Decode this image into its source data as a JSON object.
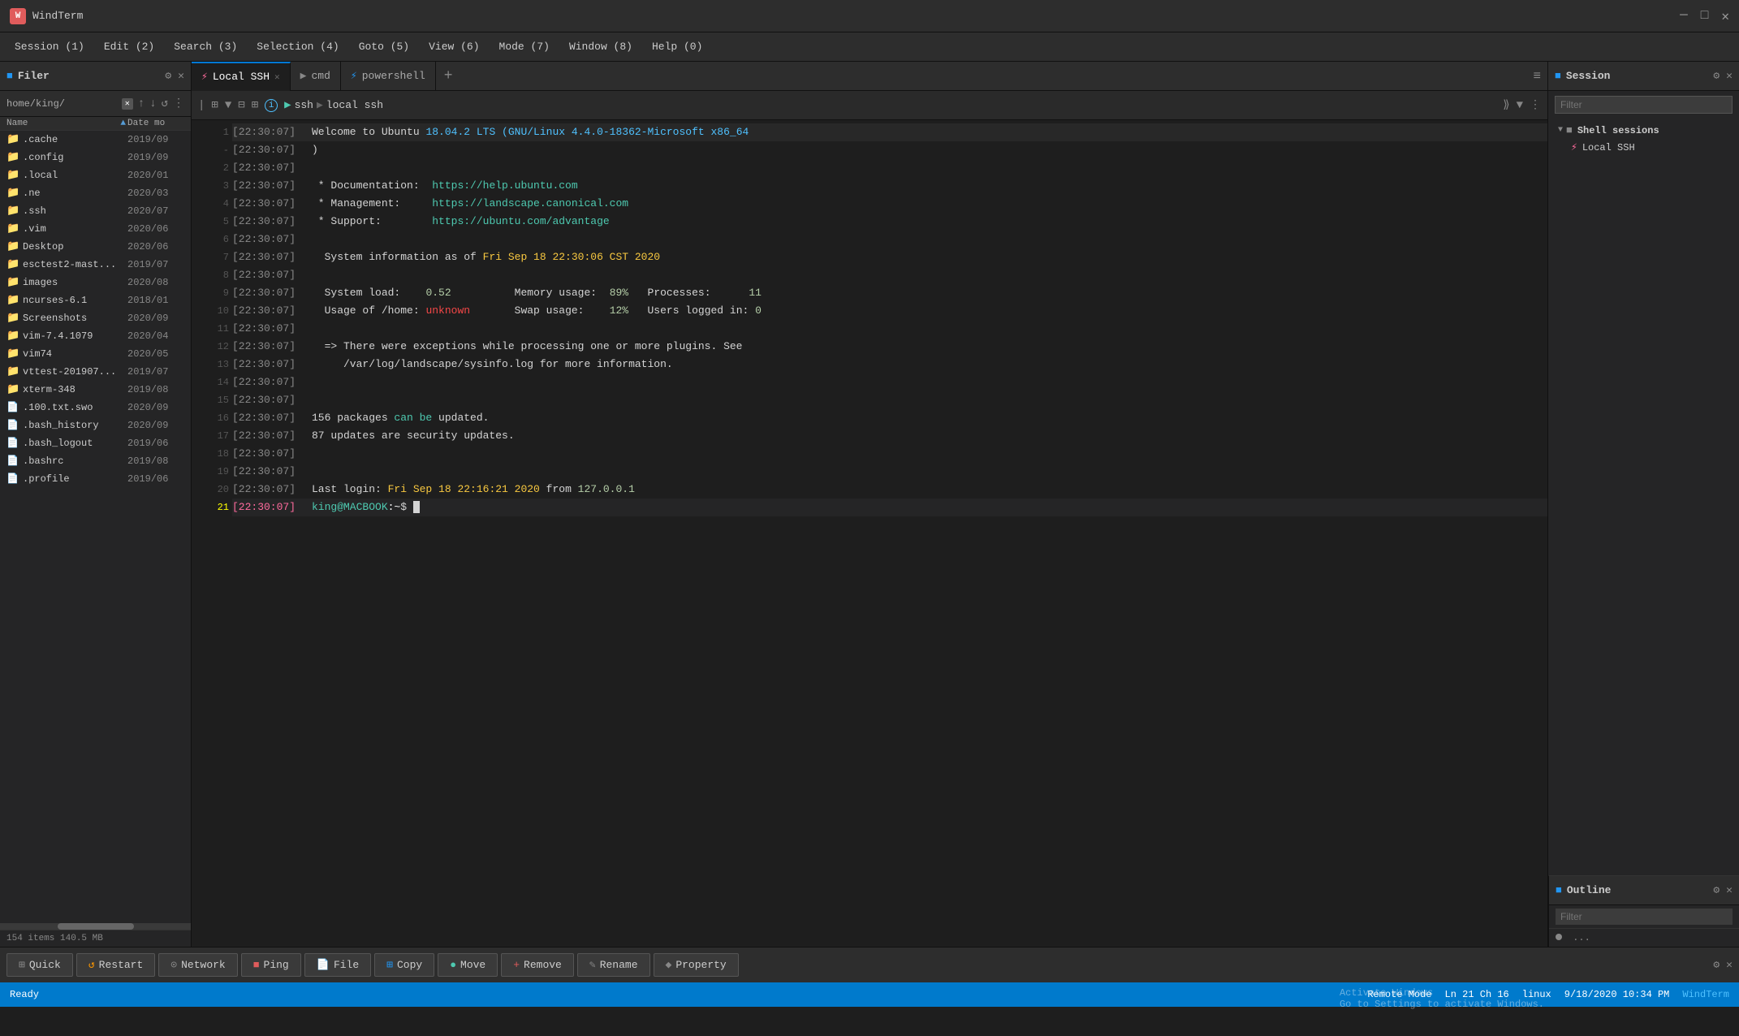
{
  "app": {
    "title": "WindTerm",
    "icon": "W"
  },
  "menu": {
    "items": [
      {
        "label": "Session (1)"
      },
      {
        "label": "Edit (2)"
      },
      {
        "label": "Search (3)"
      },
      {
        "label": "Selection (4)"
      },
      {
        "label": "Goto (5)"
      },
      {
        "label": "View (6)"
      },
      {
        "label": "Mode (7)"
      },
      {
        "label": "Window (8)"
      },
      {
        "label": "Help (0)"
      }
    ]
  },
  "filer": {
    "title": "Filer",
    "path": "home/king/",
    "status": "154 items  140.5 MB",
    "items": [
      {
        "name": ".cache",
        "date": "2019/09",
        "type": "folder"
      },
      {
        "name": ".config",
        "date": "2019/09",
        "type": "folder"
      },
      {
        "name": ".local",
        "date": "2020/01",
        "type": "folder"
      },
      {
        "name": ".ne",
        "date": "2020/03",
        "type": "folder"
      },
      {
        "name": ".ssh",
        "date": "2020/07",
        "type": "folder"
      },
      {
        "name": ".vim",
        "date": "2020/06",
        "type": "folder"
      },
      {
        "name": "Desktop",
        "date": "2020/06",
        "type": "folder"
      },
      {
        "name": "esctest2-mast...",
        "date": "2019/07",
        "type": "folder"
      },
      {
        "name": "images",
        "date": "2020/08",
        "type": "folder"
      },
      {
        "name": "ncurses-6.1",
        "date": "2018/01",
        "type": "folder"
      },
      {
        "name": "Screenshots",
        "date": "2020/09",
        "type": "folder"
      },
      {
        "name": "vim-7.4.1079",
        "date": "2020/04",
        "type": "folder"
      },
      {
        "name": "vim74",
        "date": "2020/05",
        "type": "folder"
      },
      {
        "name": "vttest-201907...",
        "date": "2019/07",
        "type": "folder"
      },
      {
        "name": "xterm-348",
        "date": "2019/08",
        "type": "folder"
      },
      {
        "name": ".100.txt.swo",
        "date": "2020/09",
        "type": "file"
      },
      {
        "name": ".bash_history",
        "date": "2020/09",
        "type": "file"
      },
      {
        "name": ".bash_logout",
        "date": "2019/06",
        "type": "file"
      },
      {
        "name": ".bashrc",
        "date": "2019/08",
        "type": "file"
      },
      {
        "name": ".profile",
        "date": "2019/06",
        "type": "file"
      }
    ]
  },
  "tabs": [
    {
      "label": "Local SSH",
      "type": "ssh",
      "active": true,
      "closable": true
    },
    {
      "label": "cmd",
      "type": "cmd",
      "active": false,
      "closable": false
    },
    {
      "label": "powershell",
      "type": "ps",
      "active": false,
      "closable": false
    }
  ],
  "terminal": {
    "path_parts": [
      "ssh",
      "local ssh"
    ],
    "lines": [
      {
        "num": "1",
        "time": "[22:30:07]",
        "text": "Welcome to Ubuntu 18.04.2 LTS (GNU/Linux 4.4.0-18362-Microsoft x86_64",
        "type": "welcome"
      },
      {
        "num": "-",
        "time": "[22:30:07]",
        "text": ")",
        "type": "normal"
      },
      {
        "num": "2",
        "time": "[22:30:07]",
        "text": "",
        "type": "empty"
      },
      {
        "num": "3",
        "time": "[22:30:07]",
        "text": " * Documentation:  https://help.ubuntu.com",
        "type": "doc"
      },
      {
        "num": "4",
        "time": "[22:30:07]",
        "text": " * Management:     https://landscape.canonical.com",
        "type": "doc"
      },
      {
        "num": "5",
        "time": "[22:30:07]",
        "text": " * Support:        https://ubuntu.com/advantage",
        "type": "doc"
      },
      {
        "num": "6",
        "time": "[22:30:07]",
        "text": "",
        "type": "empty"
      },
      {
        "num": "7",
        "time": "[22:30:07]",
        "text": "  System information as of Fri Sep 18 22:30:06 CST 2020",
        "type": "sysinfo"
      },
      {
        "num": "8",
        "time": "[22:30:07]",
        "text": "",
        "type": "empty"
      },
      {
        "num": "9",
        "time": "[22:30:07]",
        "text": "  System load:    0.52          Memory usage:  89%   Processes:      11",
        "type": "stats"
      },
      {
        "num": "10",
        "time": "[22:30:07]",
        "text": "  Usage of /home: unknown       Swap usage:    12%   Users logged in: 0",
        "type": "stats"
      },
      {
        "num": "11",
        "time": "[22:30:07]",
        "text": "",
        "type": "empty"
      },
      {
        "num": "12",
        "time": "[22:30:07]",
        "text": "  => There were exceptions while processing one or more plugins. See",
        "type": "warning"
      },
      {
        "num": "13",
        "time": "[22:30:07]",
        "text": "     /var/log/landscape/sysinfo.log for more information.",
        "type": "warning"
      },
      {
        "num": "14",
        "time": "[22:30:07]",
        "text": "",
        "type": "empty"
      },
      {
        "num": "15",
        "time": "[22:30:07]",
        "text": "",
        "type": "empty"
      },
      {
        "num": "16",
        "time": "[22:30:07]",
        "text": "156 packages can be updated.",
        "type": "update"
      },
      {
        "num": "17",
        "time": "[22:30:07]",
        "text": "87 updates are security updates.",
        "type": "update"
      },
      {
        "num": "18",
        "time": "[22:30:07]",
        "text": "",
        "type": "empty"
      },
      {
        "num": "19",
        "time": "[22:30:07]",
        "text": "",
        "type": "empty"
      },
      {
        "num": "20",
        "time": "[22:30:07]",
        "text": "Last login: Fri Sep 18 22:16:21 2020 from 127.0.0.1",
        "type": "login"
      },
      {
        "num": "21",
        "time": "[22:30:07]",
        "text": "king@MACBOOK:~$ ",
        "type": "prompt",
        "active": true
      }
    ]
  },
  "session_panel": {
    "title": "Session",
    "filter_placeholder": "Filter",
    "items": [
      {
        "label": "Shell sessions",
        "type": "group"
      },
      {
        "label": "Local SSH",
        "type": "ssh",
        "indent": true
      }
    ]
  },
  "outline_panel": {
    "title": "Outline",
    "filter_placeholder": "Filter",
    "content": "..."
  },
  "bottom_toolbar": {
    "buttons": [
      {
        "label": "Quick",
        "icon": "⊞",
        "icon_class": "btn-icon-quick"
      },
      {
        "label": "Restart",
        "icon": "↺",
        "icon_class": "btn-icon-restart"
      },
      {
        "label": "Network",
        "icon": "⊙",
        "icon_class": "btn-icon-network"
      },
      {
        "label": "Ping",
        "icon": "■",
        "icon_class": "btn-icon-ping"
      },
      {
        "label": "File",
        "icon": "📄",
        "icon_class": "btn-icon-file"
      },
      {
        "label": "Copy",
        "icon": "⊞",
        "icon_class": "btn-icon-copy"
      },
      {
        "label": "Move",
        "icon": "●",
        "icon_class": "btn-icon-move"
      },
      {
        "label": "Remove",
        "icon": "+",
        "icon_class": "btn-icon-remove"
      },
      {
        "label": "Rename",
        "icon": "✎",
        "icon_class": "btn-icon-rename"
      },
      {
        "label": "Property",
        "icon": "◆",
        "icon_class": "btn-icon-property"
      }
    ]
  },
  "status_bar": {
    "ready": "Ready",
    "remote_mode": "Remote Mode",
    "position": "Ln 21  Ch 16",
    "os": "linux",
    "datetime": "9/18/2020  10:34 PM",
    "app": "WindTerm"
  }
}
